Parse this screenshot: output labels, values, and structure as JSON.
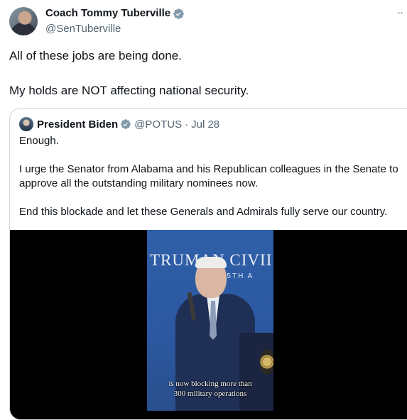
{
  "tweet": {
    "author_name": "Coach Tommy Tuberville",
    "handle": "@SenTuberville",
    "more_label": "··",
    "text_lines": [
      "All of these jobs are being done.",
      "My holds are NOT affecting national security."
    ]
  },
  "quote": {
    "author_name": "President Biden",
    "handle": "@POTUS",
    "separator": "·",
    "date": "Jul 28",
    "paragraphs": [
      "Enough.",
      "I urge the Senator from Alabama and his Republican colleagues in the Senate to approve all the outstanding military nominees now.",
      "End this blockade and let these Generals and Admirals fully serve our country."
    ],
    "media": {
      "banner_line1": "TRUMAN CIVII",
      "banner_line2": "NAL 75TH A",
      "caption_line1": "is now blocking more than",
      "caption_line2": "300 military operations"
    }
  },
  "colors": {
    "verified": "#1d9bf0",
    "secondary_text": "#536471",
    "border": "#cfd9de"
  }
}
